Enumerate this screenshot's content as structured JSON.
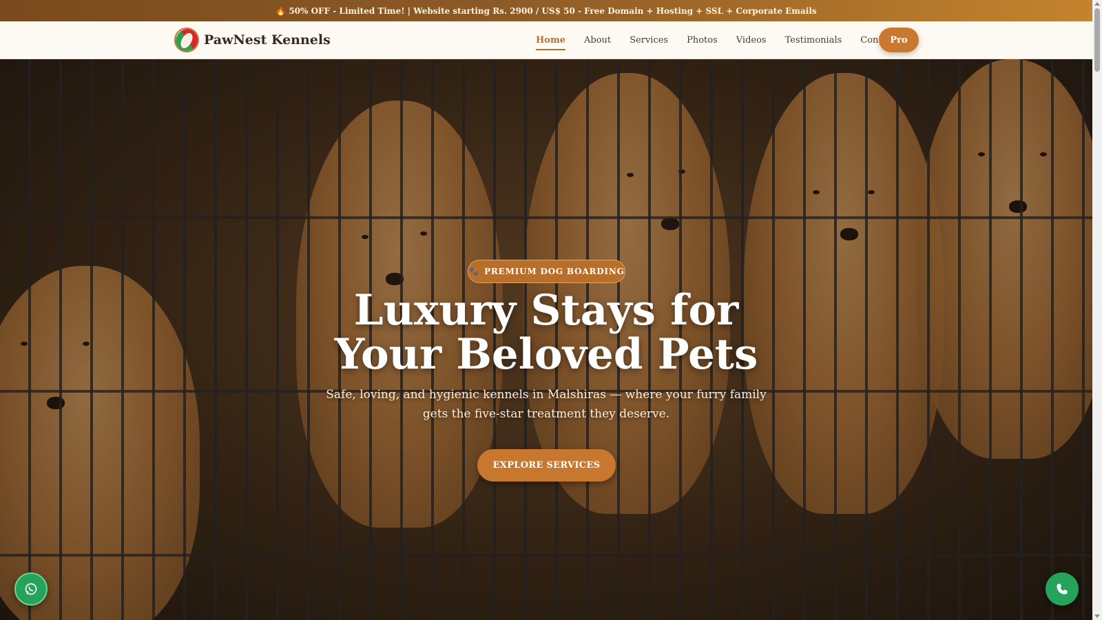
{
  "promo": {
    "icon": "fire-icon",
    "text": "50% OFF - Limited Time! | Website starting Rs. 2900 / US$ 50 - Free Domain + Hosting + SSL + Corporate Emails"
  },
  "nav": {
    "brand": "PawNest Kennels",
    "items": [
      {
        "label": "Home",
        "active": true
      },
      {
        "label": "About"
      },
      {
        "label": "Services"
      },
      {
        "label": "Photos"
      },
      {
        "label": "Videos"
      },
      {
        "label": "Testimonials"
      },
      {
        "label": "Contact"
      }
    ],
    "pro_label": "Pro"
  },
  "hero": {
    "badge": "PREMIUM DOG BOARDING",
    "title": "Luxury Stays for Your Beloved Pets",
    "subtitle": "Safe, loving, and hygienic kennels in Malshiras — where your furry family gets the five-star treatment they deserve.",
    "cta": "EXPLORE SERVICES"
  },
  "floating": {
    "whatsapp_icon": "whatsapp-icon",
    "call_icon": "phone-icon"
  },
  "colors": {
    "accent": "#c8782e",
    "promo_bg": "#8b5a26",
    "nav_bg": "#fdfaf3",
    "fab_green": "#25a35a"
  }
}
